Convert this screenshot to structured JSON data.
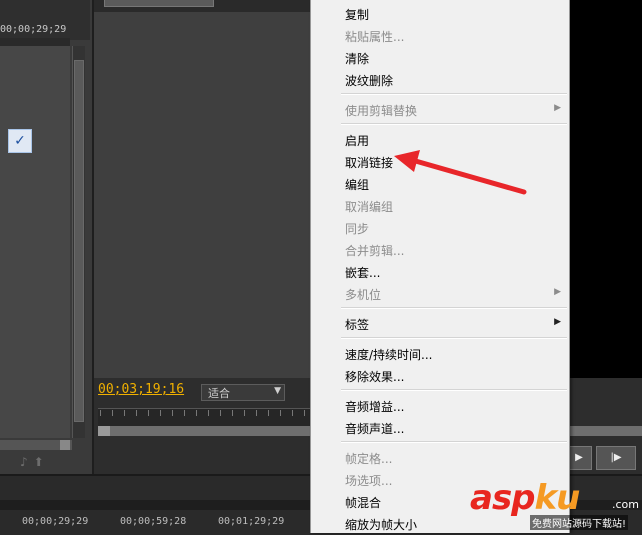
{
  "source_monitor": {
    "timecode": "00;00;29;29",
    "icons": [
      "audio-scrub-icon",
      "export-frame-icon"
    ]
  },
  "program_monitor": {
    "timecode": "00;03;19;16",
    "fit_select": "适合"
  },
  "timeline": {
    "labels": [
      "00;00;29;29",
      "00;00;59;28",
      "00;01;29;29"
    ]
  },
  "context_menu": {
    "items": [
      {
        "label": "复制",
        "enabled": true
      },
      {
        "label": "粘贴属性...",
        "enabled": false
      },
      {
        "label": "清除",
        "enabled": true
      },
      {
        "label": "波纹删除",
        "enabled": true
      },
      {
        "label": "使用剪辑替换",
        "enabled": false,
        "submenu": true
      },
      {
        "label": "启用",
        "enabled": true,
        "checked": true
      },
      {
        "label": "取消链接",
        "enabled": true
      },
      {
        "label": "编组",
        "enabled": true
      },
      {
        "label": "取消编组",
        "enabled": false
      },
      {
        "label": "同步",
        "enabled": false
      },
      {
        "label": "合并剪辑...",
        "enabled": false
      },
      {
        "label": "嵌套...",
        "enabled": true
      },
      {
        "label": "多机位",
        "enabled": false,
        "submenu": true
      },
      {
        "label": "标签",
        "enabled": true,
        "submenu": true
      },
      {
        "label": "速度/持续时间...",
        "enabled": true
      },
      {
        "label": "移除效果...",
        "enabled": true
      },
      {
        "label": "音频增益...",
        "enabled": true
      },
      {
        "label": "音频声道...",
        "enabled": true
      },
      {
        "label": "帧定格...",
        "enabled": false
      },
      {
        "label": "场选项...",
        "enabled": false
      },
      {
        "label": "帧混合",
        "enabled": true
      },
      {
        "label": "缩放为帧大小",
        "enabled": true
      }
    ]
  },
  "watermark": {
    "brand_a": "asp",
    "brand_k": "ku",
    "domain": ".com",
    "tagline": "免费网站源码下载站!"
  },
  "colors": {
    "timecode": "#f0b000",
    "arrow": "#e8262a",
    "menu_bg": "#f0f0f0"
  }
}
